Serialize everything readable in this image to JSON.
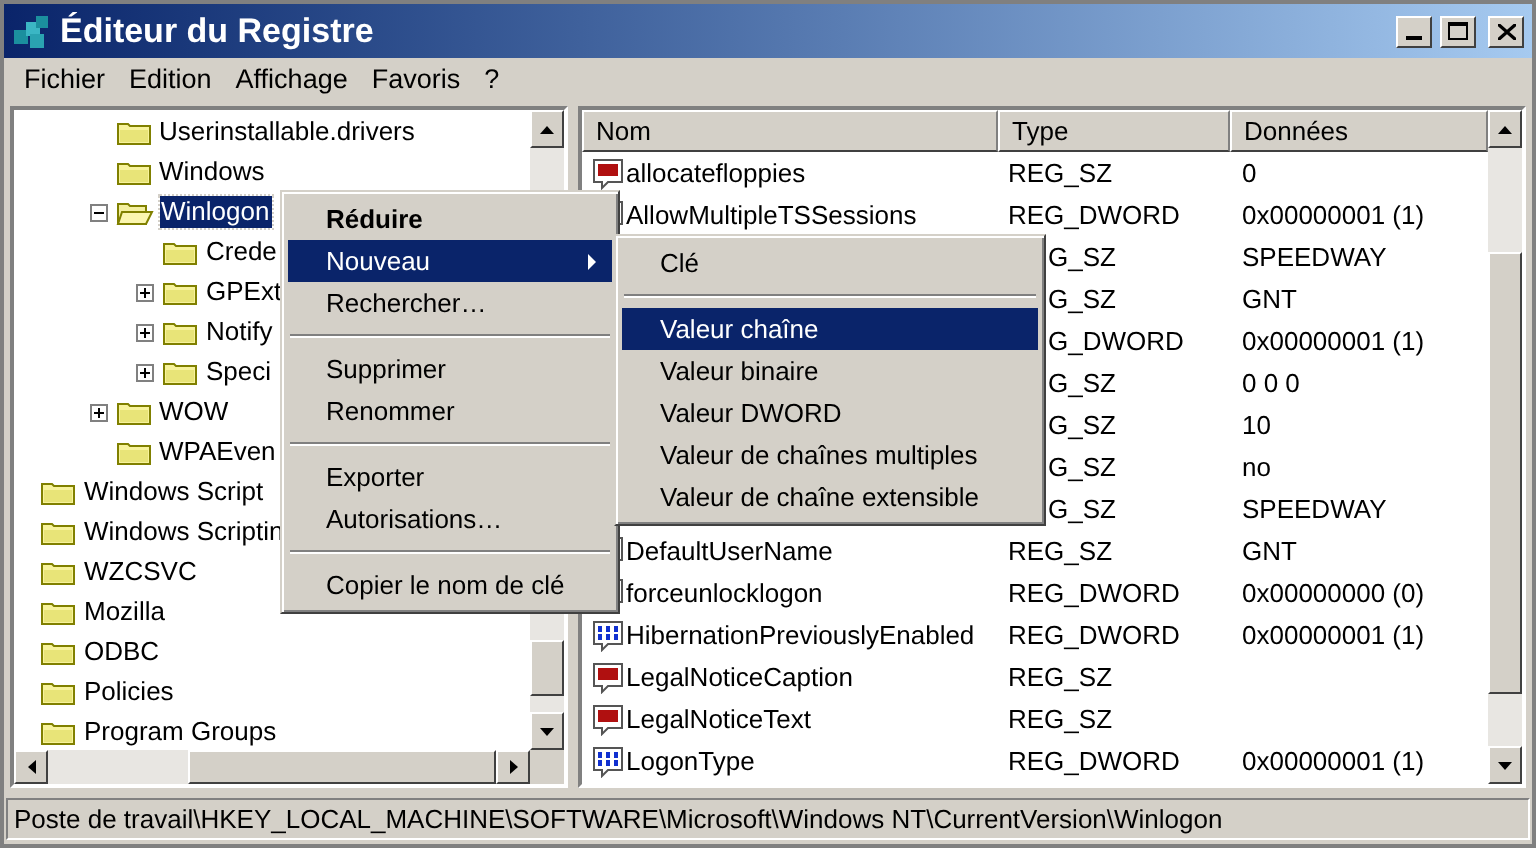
{
  "window": {
    "title": "Éditeur du Registre"
  },
  "menu_bar": [
    "Fichier",
    "Edition",
    "Affichage",
    "Favoris",
    "?"
  ],
  "tree": {
    "items": [
      {
        "children": [
          {
            "children": [
              {
                "children": [
                  {
                    "label": "Userinstallable.drivers",
                    "selected": false
                  },
                  {
                    "label": "Windows",
                    "selected": false
                  },
                  {
                    "label": "Winlogon",
                    "selected": true,
                    "expanded": true,
                    "children": [
                      {
                        "label": "Crede",
                        "selected": false
                      },
                      {
                        "label": "GPExt",
                        "selected": false,
                        "expanded": false
                      },
                      {
                        "label": "Notify",
                        "selected": false,
                        "expanded": false
                      },
                      {
                        "label": "Speci",
                        "selected": false,
                        "expanded": false
                      }
                    ]
                  },
                  {
                    "label": "WOW",
                    "selected": false,
                    "expanded": false
                  },
                  {
                    "label": "WPAEven",
                    "selected": false
                  }
                ]
              }
            ]
          },
          {
            "label": "Windows Script",
            "selected": false
          },
          {
            "label": "Windows Scriptin",
            "selected": false
          },
          {
            "label": "WZCSVC",
            "selected": false
          }
        ]
      },
      {
        "label": "Mozilla",
        "selected": false
      },
      {
        "label": "ODBC",
        "selected": false
      },
      {
        "label": "Policies",
        "selected": false
      },
      {
        "label": "Program Groups",
        "selected": false
      }
    ]
  },
  "values_list": {
    "columns": [
      "Nom",
      "Type",
      "Données"
    ],
    "rows": [
      {
        "kind": "string",
        "name": "allocatefloppies",
        "type": "REG_SZ",
        "data": "0"
      },
      {
        "kind": "dword",
        "name": "AllowMultipleTSSessions",
        "type": "REG_DWORD",
        "data": "0x00000001 (1)"
      },
      {
        "kind": "covered",
        "type": "G_SZ",
        "data": "SPEEDWAY"
      },
      {
        "kind": "covered",
        "type": "G_SZ",
        "data": "GNT"
      },
      {
        "kind": "covered",
        "type": "G_DWORD",
        "data": "0x00000001 (1)"
      },
      {
        "kind": "covered",
        "type": "G_SZ",
        "data": "0 0 0"
      },
      {
        "kind": "covered",
        "type": "G_SZ",
        "data": "10"
      },
      {
        "kind": "covered",
        "type": "G_SZ",
        "data": "no"
      },
      {
        "kind": "covered",
        "type": "G_SZ",
        "data": "SPEEDWAY"
      },
      {
        "kind": "string",
        "name": "DefaultUserName",
        "type": "REG_SZ",
        "data": "GNT"
      },
      {
        "kind": "dword",
        "name": "forceunlocklogon",
        "type": "REG_DWORD",
        "data": "0x00000000 (0)"
      },
      {
        "kind": "dword",
        "name": "HibernationPreviouslyEnabled",
        "type": "REG_DWORD",
        "data": "0x00000001 (1)"
      },
      {
        "kind": "string",
        "name": "LegalNoticeCaption",
        "type": "REG_SZ"
      },
      {
        "kind": "string",
        "name": "LegalNoticeText",
        "type": "REG_SZ"
      },
      {
        "kind": "dword",
        "name": "LogonType",
        "type": "REG_DWORD",
        "data": "0x00000001 (1)"
      }
    ]
  },
  "context_menu": {
    "items": [
      {
        "label": "Réduire",
        "kind": "default",
        "selected": false
      },
      {
        "label": "Nouveau",
        "kind": "submenu",
        "selected": true
      },
      {
        "label": "Rechercher…",
        "kind": "item",
        "selected": false
      },
      {
        "kind": "separator"
      },
      {
        "label": "Supprimer",
        "kind": "item",
        "selected": false
      },
      {
        "label": "Renommer",
        "kind": "item",
        "selected": false
      },
      {
        "kind": "separator"
      },
      {
        "label": "Exporter",
        "kind": "item",
        "selected": false
      },
      {
        "label": "Autorisations…",
        "kind": "item",
        "selected": false
      },
      {
        "kind": "separator"
      },
      {
        "label": "Copier le nom de clé",
        "kind": "item",
        "selected": false
      }
    ]
  },
  "submenu": {
    "items": [
      {
        "label": "Clé",
        "kind": "item",
        "selected": false
      },
      {
        "kind": "separator"
      },
      {
        "label": "Valeur chaîne",
        "kind": "item",
        "selected": true
      },
      {
        "label": "Valeur binaire",
        "kind": "item",
        "selected": false
      },
      {
        "label": "Valeur DWORD",
        "kind": "item",
        "selected": false
      },
      {
        "label": "Valeur de chaînes multiples",
        "kind": "item",
        "selected": false
      },
      {
        "label": "Valeur de chaîne extensible",
        "kind": "item",
        "selected": false
      }
    ]
  },
  "status_bar": "Poste de travail\\HKEY_LOCAL_MACHINE\\SOFTWARE\\Microsoft\\Windows NT\\CurrentVersion\\Winlogon"
}
